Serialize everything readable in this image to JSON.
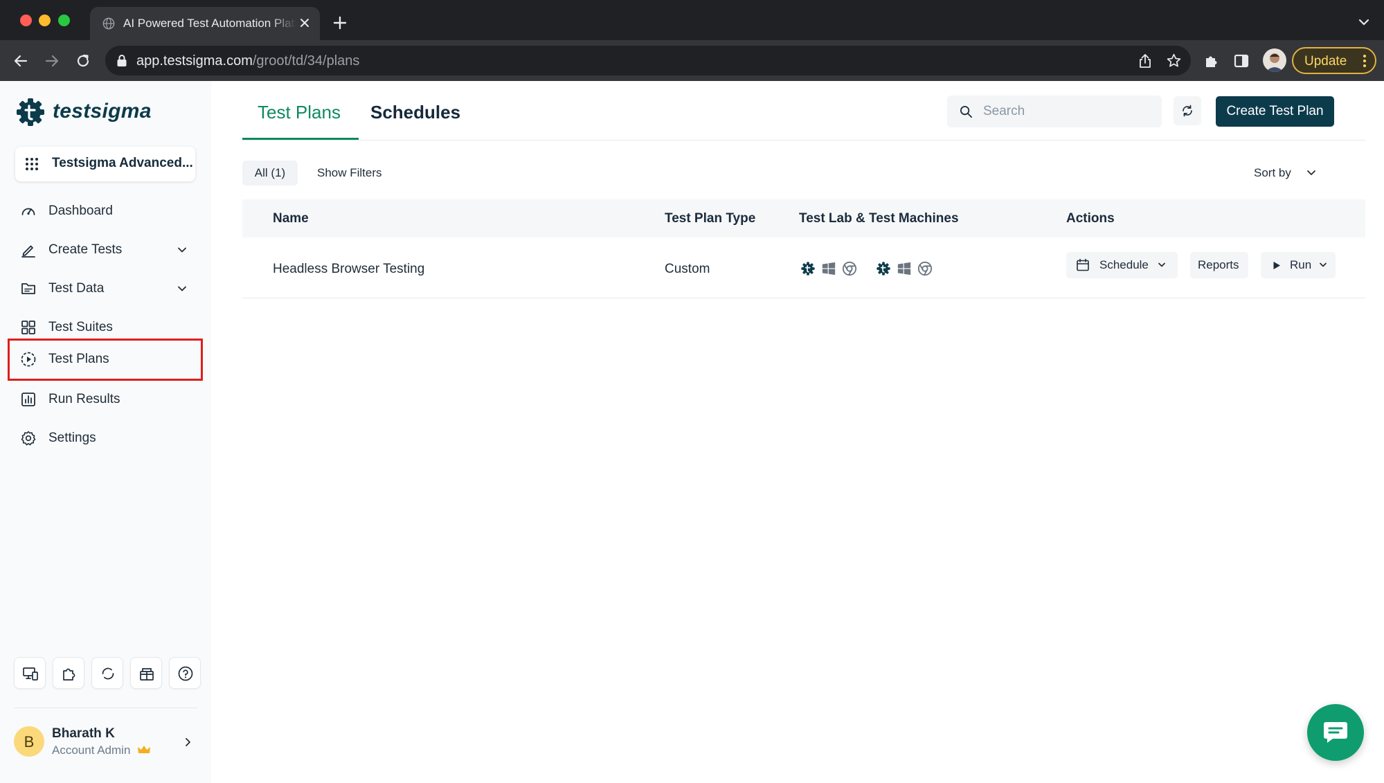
{
  "browser": {
    "tab_title": "AI Powered Test Automation Platform",
    "url_host": "app.testsigma.com",
    "url_path": "/groot/td/34/plans",
    "update_label": "Update"
  },
  "app": {
    "brand": "testsigma",
    "workspace": "Testsigma Advanced...",
    "nav": [
      {
        "label": "Dashboard",
        "icon": "dashboard-icon"
      },
      {
        "label": "Create Tests",
        "icon": "pencil-icon",
        "expandable": true
      },
      {
        "label": "Test Data",
        "icon": "folder-icon",
        "expandable": true
      },
      {
        "label": "Test Suites",
        "icon": "grid-icon"
      },
      {
        "label": "Test Plans",
        "icon": "play-circle-icon",
        "active": true
      },
      {
        "label": "Run Results",
        "icon": "bar-chart-icon"
      },
      {
        "label": "Settings",
        "icon": "gear-icon"
      }
    ],
    "bottom_tools": [
      "device-icon",
      "puzzle-icon",
      "refresh-circle-icon",
      "gift-icon",
      "help-icon"
    ],
    "user": {
      "initial": "B",
      "name": "Bharath K",
      "role": "Account Admin"
    }
  },
  "main": {
    "tabs": [
      "Test Plans",
      "Schedules"
    ],
    "search_placeholder": "Search",
    "create_button": "Create Test Plan",
    "filters": {
      "all": "All (1)",
      "show": "Show Filters"
    },
    "sort_label": "Sort by",
    "table": {
      "headers": [
        "Name",
        "Test Plan Type",
        "Test Lab & Test Machines",
        "Actions"
      ],
      "rows": [
        {
          "name": "Headless Browser Testing",
          "type": "Custom"
        }
      ]
    },
    "actions": {
      "schedule": "Schedule",
      "reports": "Reports",
      "run": "Run"
    }
  },
  "colors": {
    "brand_dark": "#0c3b4c",
    "accent_green": "#0f8a5f",
    "highlight_red": "#e11d1d"
  }
}
